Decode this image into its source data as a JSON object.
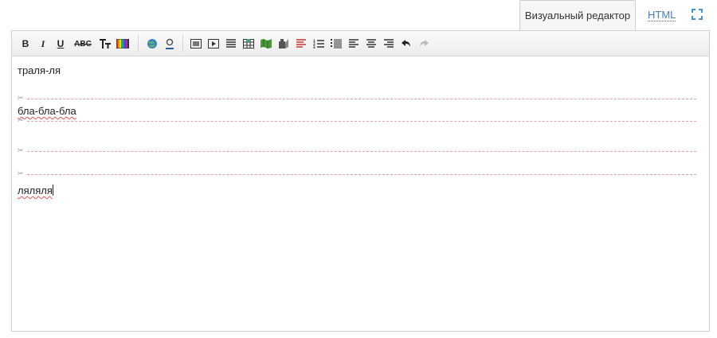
{
  "tabs": {
    "visual_label": "Визуальный редактор",
    "html_label": "HTML",
    "fullscreen_icon": "fullscreen-icon"
  },
  "toolbar": {
    "bold_label": "B",
    "italic_label": "I",
    "underline_label": "U",
    "strike_label": "ABC",
    "icons": [
      "bold-icon",
      "italic-icon",
      "underline-icon",
      "strikethrough-icon",
      "text-size-icon",
      "text-color-icon",
      "link-icon",
      "anchor-icon",
      "insert-image-icon",
      "insert-video-icon",
      "horizontal-rule-icon",
      "insert-table-icon",
      "insert-map-icon",
      "insert-file-icon",
      "paragraph-format-icon",
      "ordered-list-icon",
      "unordered-list-icon",
      "align-left-icon",
      "align-center-icon",
      "align-right-icon",
      "undo-icon",
      "redo-icon"
    ]
  },
  "content": {
    "para1": "траля-ля",
    "para2": "бла-бла-бла",
    "para3": "ляляля"
  },
  "colors": {
    "accent_link": "#4a7fb5",
    "page_break": "#e2a1a1",
    "spell_error": "#e15555"
  }
}
